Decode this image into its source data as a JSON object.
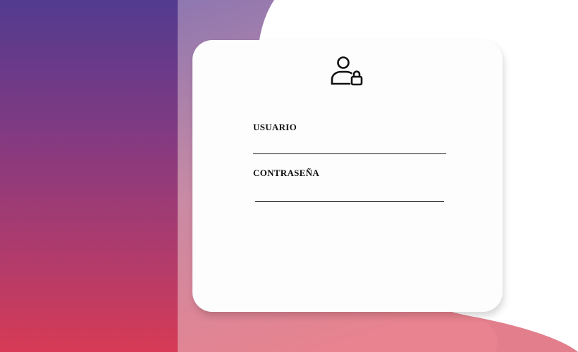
{
  "login": {
    "icon": "user-lock-icon",
    "username": {
      "label": "USUARIO",
      "value": "",
      "placeholder": ""
    },
    "password": {
      "label": "CONTRASEÑA",
      "value": "",
      "placeholder": ""
    }
  },
  "colors": {
    "gradient_top": "#523b8f",
    "gradient_bottom": "#d73b55",
    "card_background": "#fdfdfd"
  }
}
